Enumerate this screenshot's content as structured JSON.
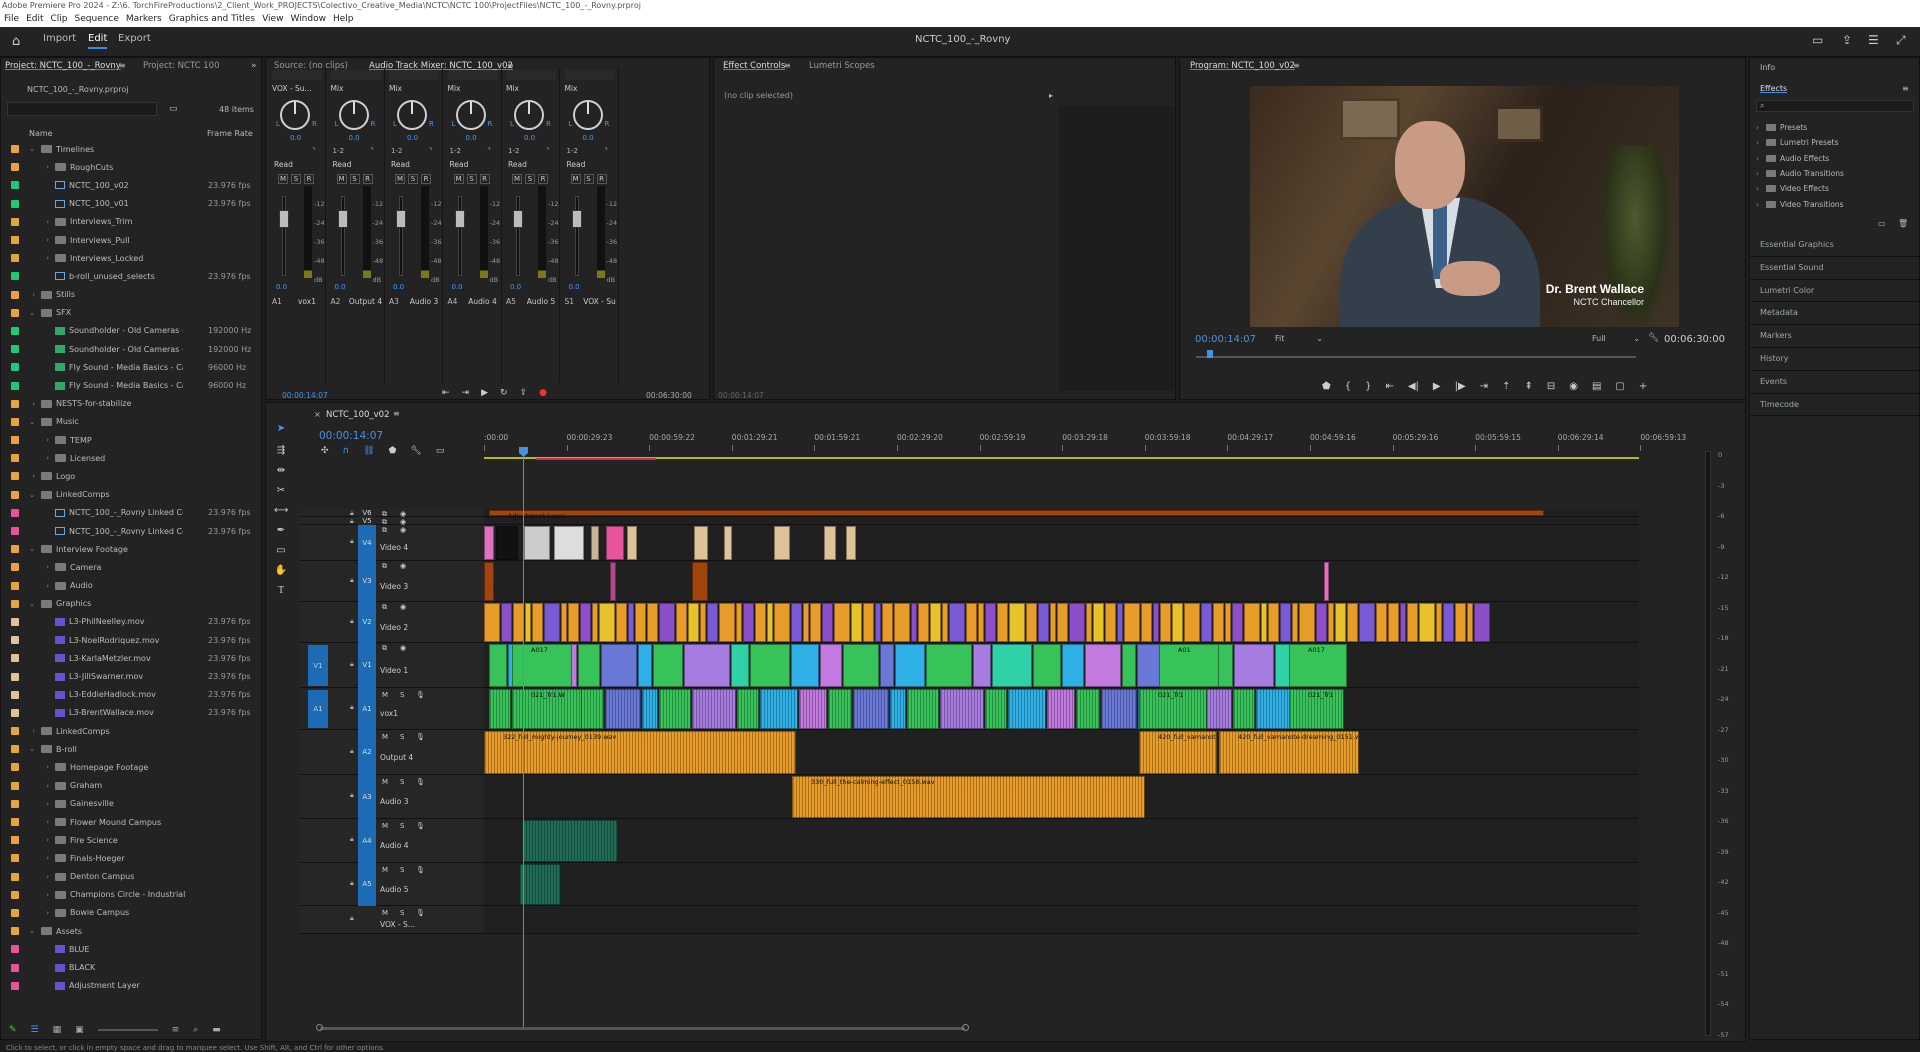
{
  "window": {
    "title": "Adobe Premiere Pro 2024 - Z:\\6. TorchFireProductions\\2_Client_Work_PROJECTS\\Colectivo_Creative_Media\\NCTC\\NCTC 100\\ProjectFiles\\NCTC_100_-_Rovny.prproj"
  },
  "menu": [
    "File",
    "Edit",
    "Clip",
    "Sequence",
    "Markers",
    "Graphics and Titles",
    "View",
    "Window",
    "Help"
  ],
  "header": {
    "tabs": [
      "Import",
      "Edit",
      "Export"
    ],
    "active": "Edit",
    "doc_title": "NCTC_100_-_Rovny"
  },
  "project": {
    "tab_active": "Project: NCTC_100_-_Rovny",
    "tab_other": "Project: NCTC 100",
    "file": "NCTC_100_-_Rovny.prproj",
    "count": "48 items",
    "col_name": "Name",
    "col_rate": "Frame Rate",
    "rows": [
      {
        "n": "Timelines",
        "c": "#e8a33d",
        "ind": 1,
        "t": "folder",
        "open": true,
        "r": ""
      },
      {
        "n": "RoughCuts",
        "c": "#e8a33d",
        "ind": 2,
        "t": "folder",
        "r": ""
      },
      {
        "n": "NCTC_100_v02",
        "c": "#1fc97a",
        "ind": 2,
        "t": "seq",
        "r": "23.976 fps"
      },
      {
        "n": "NCTC_100_v01",
        "c": "#1fc97a",
        "ind": 2,
        "t": "seq",
        "r": "23.976 fps"
      },
      {
        "n": "Interviews_Trim",
        "c": "#e8a33d",
        "ind": 2,
        "t": "folder",
        "r": ""
      },
      {
        "n": "Interviews_Pull",
        "c": "#e8a33d",
        "ind": 2,
        "t": "folder",
        "r": ""
      },
      {
        "n": "Interviews_Locked",
        "c": "#e8a33d",
        "ind": 2,
        "t": "folder",
        "r": ""
      },
      {
        "n": "b-roll_unused_selects",
        "c": "#1fc97a",
        "ind": 2,
        "t": "seq",
        "r": "23.976 fps"
      },
      {
        "n": "Stills",
        "c": "#e8a33d",
        "ind": 1,
        "t": "folder",
        "r": ""
      },
      {
        "n": "SFX",
        "c": "#e8a33d",
        "ind": 1,
        "t": "folder",
        "open": true,
        "r": ""
      },
      {
        "n": "Soundholder - Old Cameras - S",
        "c": "#1fc97a",
        "ind": 2,
        "t": "aud",
        "r": "192000 Hz"
      },
      {
        "n": "Soundholder - Old Cameras - C",
        "c": "#1fc97a",
        "ind": 2,
        "t": "aud",
        "r": "192000 Hz"
      },
      {
        "n": "Fly Sound - Media Basics - Ca",
        "c": "#1fc97a",
        "ind": 2,
        "t": "aud",
        "r": "96000 Hz"
      },
      {
        "n": "Fly Sound - Media Basics - Ca",
        "c": "#1fc97a",
        "ind": 2,
        "t": "aud",
        "r": "96000 Hz"
      },
      {
        "n": "NESTS-for-stabilize",
        "c": "#e8a33d",
        "ind": 1,
        "t": "folder",
        "r": ""
      },
      {
        "n": "Music",
        "c": "#e8a33d",
        "ind": 1,
        "t": "folder",
        "open": true,
        "r": ""
      },
      {
        "n": "TEMP",
        "c": "#e8a33d",
        "ind": 2,
        "t": "folder",
        "r": ""
      },
      {
        "n": "Licensed",
        "c": "#e8a33d",
        "ind": 2,
        "t": "folder",
        "r": ""
      },
      {
        "n": "Logo",
        "c": "#e8a33d",
        "ind": 1,
        "t": "folder",
        "r": ""
      },
      {
        "n": "LinkedComps",
        "c": "#e8a33d",
        "ind": 1,
        "t": "folder",
        "open": true,
        "r": ""
      },
      {
        "n": "NCTC_100_-_Rovny Linked Co",
        "c": "#e8549b",
        "ind": 2,
        "t": "seq",
        "r": "23.976 fps"
      },
      {
        "n": "NCTC_100_-_Rovny Linked Co",
        "c": "#e8549b",
        "ind": 2,
        "t": "seq",
        "r": "23.976 fps"
      },
      {
        "n": "Interview Footage",
        "c": "#e8a33d",
        "ind": 1,
        "t": "folder",
        "open": true,
        "r": ""
      },
      {
        "n": "Camera",
        "c": "#e8a33d",
        "ind": 2,
        "t": "folder",
        "r": ""
      },
      {
        "n": "Audio",
        "c": "#e8a33d",
        "ind": 2,
        "t": "folder",
        "r": ""
      },
      {
        "n": "Graphics",
        "c": "#e8a33d",
        "ind": 1,
        "t": "folder",
        "open": true,
        "r": ""
      },
      {
        "n": "L3-PhilNeelley.mov",
        "c": "#e0c29a",
        "ind": 2,
        "t": "clip",
        "r": "23.976 fps"
      },
      {
        "n": "L3-NoelRodriquez.mov",
        "c": "#e0c29a",
        "ind": 2,
        "t": "clip",
        "r": "23.976 fps"
      },
      {
        "n": "L3-KarlaMetzler.mov",
        "c": "#e0c29a",
        "ind": 2,
        "t": "clip",
        "r": "23.976 fps"
      },
      {
        "n": "L3-JillSwarner.mov",
        "c": "#e0c29a",
        "ind": 2,
        "t": "clip",
        "r": "23.976 fps"
      },
      {
        "n": "L3-EddieHadlock.mov",
        "c": "#e0c29a",
        "ind": 2,
        "t": "clip",
        "r": "23.976 fps"
      },
      {
        "n": "L3-BrentWallace.mov",
        "c": "#e0c29a",
        "ind": 2,
        "t": "clip",
        "r": "23.976 fps"
      },
      {
        "n": "LinkedComps",
        "c": "#e8a33d",
        "ind": 1,
        "t": "folder",
        "r": ""
      },
      {
        "n": "B-roll",
        "c": "#e8a33d",
        "ind": 1,
        "t": "folder",
        "open": true,
        "r": ""
      },
      {
        "n": "Homepage Footage",
        "c": "#e8a33d",
        "ind": 2,
        "t": "folder",
        "r": ""
      },
      {
        "n": "Graham",
        "c": "#e8a33d",
        "ind": 2,
        "t": "folder",
        "r": ""
      },
      {
        "n": "Gainesville",
        "c": "#e8a33d",
        "ind": 2,
        "t": "folder",
        "r": ""
      },
      {
        "n": "Flower Mound Campus",
        "c": "#e8a33d",
        "ind": 2,
        "t": "folder",
        "r": ""
      },
      {
        "n": "Fire Science",
        "c": "#e8a33d",
        "ind": 2,
        "t": "folder",
        "r": ""
      },
      {
        "n": "Finals-Hoeger",
        "c": "#e8a33d",
        "ind": 2,
        "t": "folder",
        "r": ""
      },
      {
        "n": "Denton Campus",
        "c": "#e8a33d",
        "ind": 2,
        "t": "folder",
        "r": ""
      },
      {
        "n": "Champions Circle - Industrial",
        "c": "#e8a33d",
        "ind": 2,
        "t": "folder",
        "r": ""
      },
      {
        "n": "Bowie Campus",
        "c": "#e8a33d",
        "ind": 2,
        "t": "folder",
        "r": ""
      },
      {
        "n": "Assets",
        "c": "#e8a33d",
        "ind": 1,
        "t": "folder",
        "open": true,
        "r": ""
      },
      {
        "n": "BLUE",
        "c": "#e8549b",
        "ind": 2,
        "t": "clip",
        "r": ""
      },
      {
        "n": "BLACK",
        "c": "#e8549b",
        "ind": 2,
        "t": "clip",
        "r": ""
      },
      {
        "n": "Adjustment Layer",
        "c": "#e8549b",
        "ind": 2,
        "t": "clip",
        "r": ""
      }
    ]
  },
  "source": {
    "tab": "Source: (no clips)",
    "mixer_tab": "Audio Track Mixer: NCTC_100_v02",
    "time_left": "00:00:14:07",
    "time_right": "00:06:30:00",
    "channels": [
      {
        "preset": "VOX - Su...",
        "mode": "Mix",
        "vol": "0.0",
        "read": "Read",
        "ch": "",
        "name": "vox1",
        "id": "A1"
      },
      {
        "preset": "Mix",
        "mode": "Mix",
        "vol": "0.0",
        "read": "Read",
        "ch": "1-2",
        "name": "Output 4",
        "id": "A2"
      },
      {
        "preset": "Mix",
        "mode": "Mix",
        "vol": "0.0",
        "read": "Read",
        "ch": "1-2",
        "name": "Audio 3",
        "id": "A3"
      },
      {
        "preset": "Mix",
        "mode": "Mix",
        "vol": "0.0",
        "read": "Read",
        "ch": "1-2",
        "name": "Audio 4",
        "id": "A4"
      },
      {
        "preset": "Mix",
        "mode": "Mix",
        "vol": "0.0",
        "read": "Read",
        "ch": "1-2",
        "name": "Audio 5",
        "id": "A5"
      },
      {
        "preset": "Mix",
        "mode": "Mix",
        "vol": "0.0",
        "read": "Read",
        "ch": "1-2",
        "name": "VOX - Su",
        "id": "S1"
      }
    ],
    "scale": [
      "-12",
      "-24",
      "-36",
      "-48",
      "dB"
    ]
  },
  "effect_controls": {
    "tab": "Effect Controls",
    "tab2": "Lumetri Scopes",
    "msg": "(no clip selected)",
    "time": "00:00:14:07"
  },
  "program": {
    "tab": "Program: NCTC_100_v02",
    "timecode": "00:00:14:07",
    "fit": "Fit",
    "full": "Full",
    "duration": "00:06:30:00",
    "lower_third_name": "Dr. Brent Wallace",
    "lower_third_title": "NCTC Chancellor"
  },
  "right_panel": {
    "info": "Info",
    "effects": "Effects",
    "tree": [
      "Presets",
      "Lumetri Presets",
      "Audio Effects",
      "Audio Transitions",
      "Video Effects",
      "Video Transitions"
    ],
    "items": [
      "Essential Graphics",
      "Essential Sound",
      "Lumetri Color",
      "Metadata",
      "Markers",
      "History",
      "Events",
      "Timecode"
    ]
  },
  "timeline": {
    "tab": "NCTC_100_v02",
    "timecode": "00:00:14:07",
    "ruler": [
      ":00:00",
      "00:00:29:23",
      "00:00:59:22",
      "00:01:29:21",
      "00:01:59:21",
      "00:02:29:20",
      "00:02:59:19",
      "00:03:29:18",
      "00:03:59:18",
      "00:04:29:17",
      "00:04:59:16",
      "00:05:29:16",
      "00:05:59:15",
      "00:06:29:14",
      "00:06:59:13"
    ],
    "tracks": [
      {
        "id": "V6",
        "label": ""
      },
      {
        "id": "V5",
        "label": ""
      },
      {
        "id": "V4",
        "label": "Video 4"
      },
      {
        "id": "V3",
        "label": "Video 3"
      },
      {
        "id": "V2",
        "label": "Video 2"
      },
      {
        "id": "V1",
        "label": "Video 1"
      },
      {
        "id": "A1",
        "label": "vox1"
      },
      {
        "id": "A2",
        "label": "Output 4"
      },
      {
        "id": "A3",
        "label": "Audio 3"
      },
      {
        "id": "A4",
        "label": "Audio 4"
      },
      {
        "id": "A5",
        "label": "Audio 5"
      },
      {
        "id": "",
        "label": "VOX - S..."
      }
    ],
    "clip_labels": {
      "adj": "Adjustment Layer",
      "a017": "A017",
      "a01": "A01",
      "a017b": "A017",
      "trk1": "021_Tr1.W",
      "trk2": "021_Tr1",
      "trk3": "021_Tr1",
      "mus1": "322_full_mighty-journey_0139.wav",
      "mus2": "420_full_vamanote-dr",
      "mus3": "420_full_vamanote-dreaming_0151.wav",
      "mus4": "330_full_the-calming-effect_0158.wav"
    },
    "meter": [
      "0",
      "-3",
      "-6",
      "-9",
      "-12",
      "-15",
      "-18",
      "-21",
      "-24",
      "-27",
      "-30",
      "-33",
      "-36",
      "-39",
      "-42",
      "-45",
      "-48",
      "-51",
      "-54",
      "-57"
    ]
  },
  "status": "Click to select, or click in empty space and drag to marquee select. Use Shift, Alt, and Ctrl for other options."
}
